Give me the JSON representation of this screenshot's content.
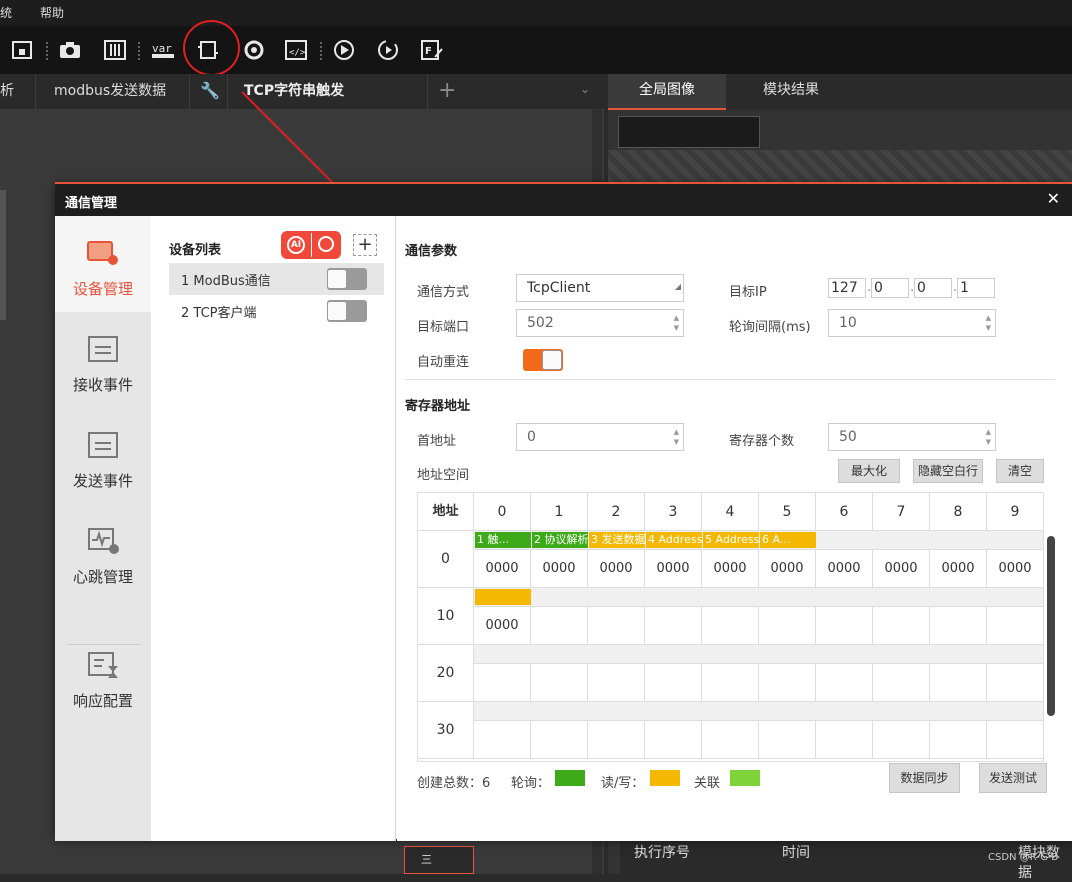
{
  "menu": {
    "system": "统",
    "help": "帮助"
  },
  "tabs": {
    "t0": "析",
    "t1": "modbus发送数据",
    "t2": "TCP字符串触发"
  },
  "right_tabs": {
    "global_image": "全局图像",
    "module_result": "模块结果"
  },
  "bottom": {
    "exec_no": "执行序号",
    "time": "时间",
    "module_data": "模块数据",
    "watermark": "CSDN @R-G-B",
    "bottom_btn": "三"
  },
  "dialog": {
    "title": "通信管理",
    "close": "✕",
    "sidebar": [
      {
        "label": "设备管理",
        "icon": "device-icon"
      },
      {
        "label": "接收事件",
        "icon": "receive-icon"
      },
      {
        "label": "发送事件",
        "icon": "send-icon"
      },
      {
        "label": "心跳管理",
        "icon": "heartbeat-icon"
      },
      {
        "label": "响应配置",
        "icon": "response-icon"
      }
    ],
    "device_list_title": "设备列表",
    "ai_badge": "AI",
    "add": "+",
    "devices": [
      {
        "label": "1 ModBus通信",
        "enabled": false
      },
      {
        "label": "2 TCP客户端",
        "enabled": false
      }
    ],
    "comm_params_title": "通信参数",
    "comm_mode_label": "通信方式",
    "comm_mode_value": "TcpClient",
    "target_ip_label": "目标IP",
    "ip": [
      "127",
      "0",
      "0",
      "1"
    ],
    "target_port_label": "目标端口",
    "target_port_value": "502",
    "poll_interval_label": "轮询间隔(ms)",
    "poll_interval_value": "10",
    "auto_reconnect_label": "自动重连",
    "auto_reconnect": true,
    "register_title": "寄存器地址",
    "start_addr_label": "首地址",
    "start_addr_value": "0",
    "reg_count_label": "寄存器个数",
    "reg_count_value": "50",
    "addr_space_label": "地址空间",
    "maximize": "最大化",
    "hide_empty": "隐藏空白行",
    "clear": "清空",
    "grid": {
      "header_addr": "地址",
      "cols": [
        "0",
        "1",
        "2",
        "3",
        "4",
        "5",
        "6",
        "7",
        "8",
        "9"
      ],
      "rows": [
        "0",
        "10",
        "20",
        "30"
      ],
      "row0_chips": [
        {
          "text": "1 触...",
          "color": "#3daa1a"
        },
        {
          "text": "2 协议解析",
          "color": "#3daa1a"
        },
        {
          "text": "3 发送数据",
          "color": "#f5b800"
        },
        {
          "text": "4 Address",
          "color": "#f5b800"
        },
        {
          "text": "5 Address",
          "color": "#f5b800"
        },
        {
          "text": "6 A...",
          "color": "#f5b800"
        }
      ],
      "row0_values": [
        "0000",
        "0000",
        "0000",
        "0000",
        "0000",
        "0000",
        "0000",
        "0000",
        "0000",
        "0000"
      ],
      "row1_value": "0000"
    },
    "total_label": "创建总数：6",
    "poll_legend": "轮询：",
    "rw_legend": "读/写：",
    "link_legend": "关联",
    "colors": {
      "poll": "#3daa1a",
      "rw": "#f5b800",
      "link": "#7fd33a",
      "accent": "#e8543a",
      "toggle_on": "#f06a1a"
    },
    "sync_button": "数据同步",
    "send_test_button": "发送测试"
  }
}
